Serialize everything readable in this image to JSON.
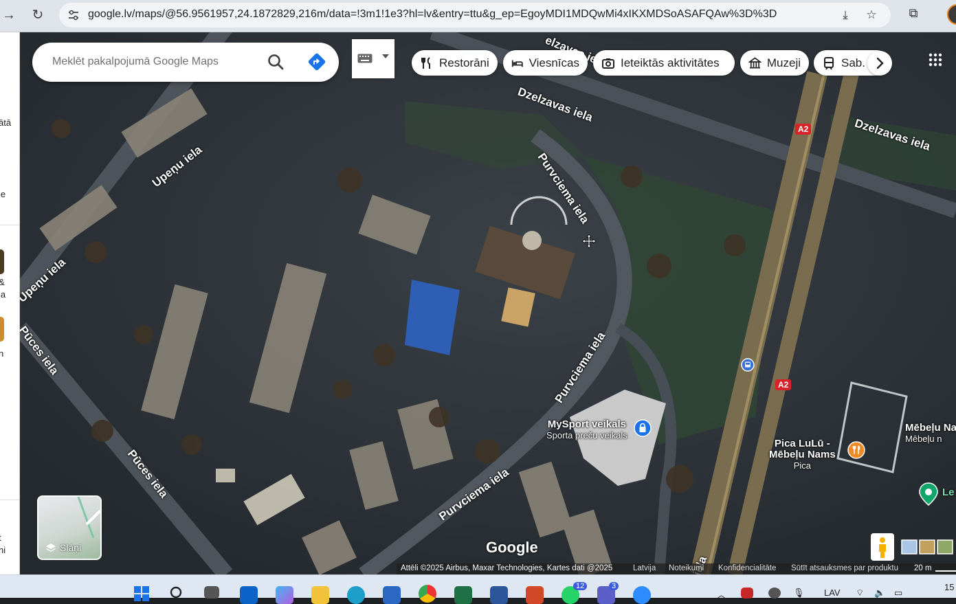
{
  "browser": {
    "url": "google.lv/maps/@56.9561957,24.1872829,216m/data=!3m1!1e3?hl=lv&entry=ttu&g_ep=EgoyMDI1MDQwMi4xIKXMDSoASAFQAw%3D%3D"
  },
  "left_panel": {
    "fragments": [
      "ātā",
      "ie",
      "&",
      "la",
      "n",
      "t",
      "ni"
    ]
  },
  "search": {
    "placeholder": "Meklēt pakalpojumā Google Maps"
  },
  "chips": [
    {
      "label": "Restorāni",
      "icon": "fork-knife-icon"
    },
    {
      "label": "Viesnīcas",
      "icon": "bed-icon"
    },
    {
      "label": "Ieteiktās aktivitātes",
      "icon": "camera-icon"
    },
    {
      "label": "Muzeji",
      "icon": "museum-icon"
    },
    {
      "label": "Sab. t",
      "icon": "transit-icon"
    }
  ],
  "streets": {
    "dzelzavas_top": "Dzelzavas iela",
    "dzelzavas_right": "Dzelzavas iela",
    "dzelzavas_topedge": "elzavas iela",
    "upenu_top": "Upeņu iela",
    "upenu_left": "Upeņu iela",
    "puces_left": "Pūces iela",
    "puces_bottom": "Pūces iela",
    "purvciema_1": "Purvciema iela",
    "purvciema_2": "Purvciema iela",
    "purvciema_3": "Purvciema iela",
    "bottom_edge": "iela"
  },
  "pois": {
    "mysport_name": "MySport veikals",
    "mysport_sub": "Sporta preču veikals",
    "pica_name": "Pica LuLū -",
    "pica_name2": "Mēbeļu Nams",
    "pica_sub": "Pica",
    "mebelu_right": "Mēbeļu Na",
    "mebelu_right_sub": "Mēbeļu n",
    "le": "Le"
  },
  "road_badges": [
    "A2",
    "A2"
  ],
  "layers": {
    "label": "Slāņi"
  },
  "logo": "Google",
  "footer": {
    "attribution": "Attēli ©2025 Airbus, Maxar Technologies, Kartes dati @2025",
    "country": "Latvija",
    "terms": "Noteikumi",
    "privacy": "Konfidencialitāte",
    "feedback": "Sūtīt atsauksmes par produktu",
    "scale": "20 m"
  },
  "taskbar": {
    "badge_whatsapp": "12",
    "badge_teams": "3",
    "lang": "LAV",
    "clock": "15"
  },
  "colors": {
    "accent_blue": "#1a73e8",
    "poi_orange": "#f08a24",
    "road_badge_red": "#d8232a",
    "poi_green": "#12a56a"
  }
}
